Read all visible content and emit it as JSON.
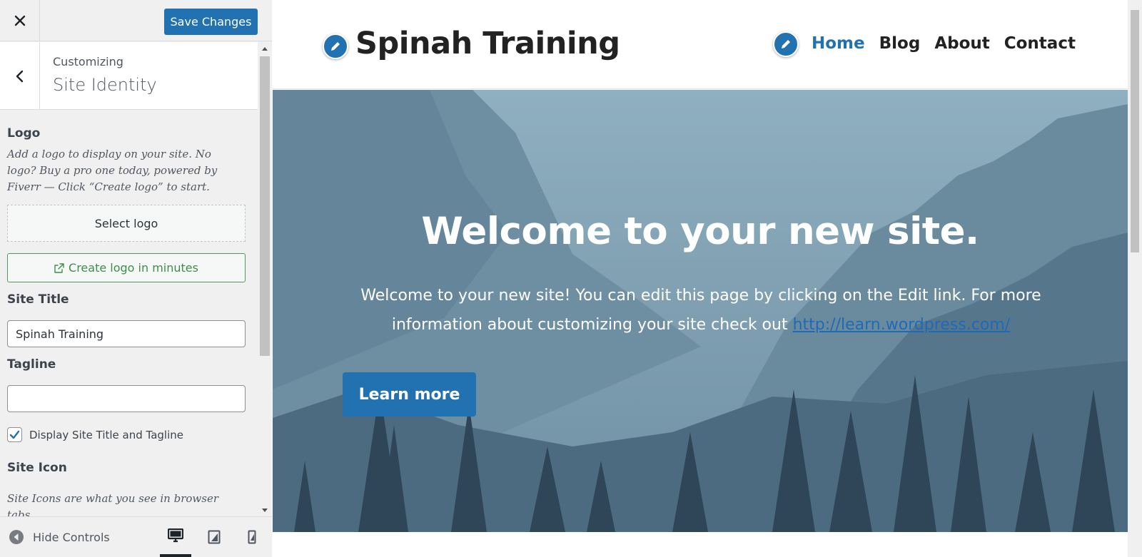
{
  "customizer": {
    "close_icon": "close-icon",
    "save_label": "Save Changes",
    "breadcrumb": "Customizing",
    "section_title": "Site Identity",
    "logo": {
      "label": "Logo",
      "description": "Add a logo to display on your site. No logo? Buy a pro one today, powered by Fiverr — Click “Create logo” to start.",
      "select_label": "Select logo",
      "create_label": "Create logo in minutes"
    },
    "site_title": {
      "label": "Site Title",
      "value": "Spinah Training"
    },
    "tagline": {
      "label": "Tagline",
      "value": ""
    },
    "display_title_tagline": {
      "label": "Display Site Title and Tagline",
      "checked": true
    },
    "site_icon": {
      "label": "Site Icon",
      "description": "Site Icons are what you see in browser tabs,"
    },
    "footer": {
      "hide_label": "Hide Controls",
      "devices": [
        "desktop",
        "tablet",
        "mobile"
      ],
      "active_device": "desktop"
    }
  },
  "preview": {
    "site_title": "Spinah Training",
    "nav": [
      {
        "label": "Home",
        "active": true
      },
      {
        "label": "Blog",
        "active": false
      },
      {
        "label": "About",
        "active": false
      },
      {
        "label": "Contact",
        "active": false
      }
    ],
    "hero": {
      "title": "Welcome to your new site.",
      "text_before_link": "Welcome to your new site! You can edit this page by clicking on the Edit link. For more information about customizing your site check out ",
      "link_text": "http://learn.wordpress.com/",
      "button_label": "Learn more"
    }
  },
  "colors": {
    "accent": "#2271b1",
    "create_logo_green": "#3d8f48",
    "hero_sky": "#7a98aa"
  }
}
